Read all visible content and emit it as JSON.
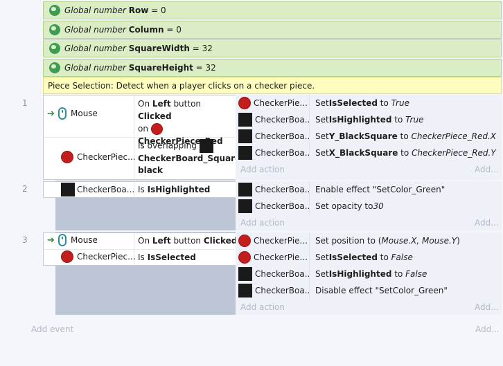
{
  "variables": [
    {
      "prefix": "Global number ",
      "name": "Row",
      "suffix": " = 0"
    },
    {
      "prefix": "Global number ",
      "name": "Column",
      "suffix": " = 0"
    },
    {
      "prefix": "Global number ",
      "name": "SquareWidth",
      "suffix": " = 32"
    },
    {
      "prefix": "Global number ",
      "name": "SquareHeight",
      "suffix": " = 32"
    }
  ],
  "comment": "Piece Selection: Detect when a player clicks on a checker piece.",
  "events": [
    {
      "number": "1",
      "conditions": [
        {
          "object": "Mouse",
          "text": {
            "p1": "On ",
            "b1": "Left",
            "p2": " button ",
            "b2": "Clicked",
            "p3": "on",
            "b3": "CheckerPiece_Red"
          }
        },
        {
          "object": "CheckerPiec...",
          "text": {
            "p1": "Is overlapping",
            "b1": "CheckerBoard_Square",
            "b2": "black"
          }
        }
      ],
      "actions": [
        {
          "object": "CheckerPie...",
          "icon": "red-piece",
          "p1": "Set ",
          "b1": "IsSelected",
          "p2": " to ",
          "i1": "True"
        },
        {
          "object": "CheckerBoa...",
          "icon": "black-square",
          "p1": "Set ",
          "b1": "IsHighlighted",
          "p2": " to ",
          "i1": "True"
        },
        {
          "object": "CheckerBoa...",
          "icon": "black-square",
          "p1": "Set ",
          "b1": "Y_BlackSquare",
          "p2": " to ",
          "i1": "CheckerPiece_Red.X"
        },
        {
          "object": "CheckerBoa...",
          "icon": "black-square",
          "p1": "Set ",
          "b1": "X_BlackSquare",
          "p2": " to ",
          "i1": "CheckerPiece_Red.Y"
        }
      ]
    },
    {
      "number": "2",
      "conditions": [
        {
          "object": "CheckerBoa...",
          "text": {
            "p1": "Is ",
            "b1": "IsHighlighted"
          }
        }
      ],
      "actions": [
        {
          "object": "CheckerBoa...",
          "icon": "black-square",
          "text": "Enable effect \"SetColor_Green\""
        },
        {
          "object": "CheckerBoa...",
          "icon": "black-square",
          "p1": "Set opacity to ",
          "i1": "30"
        }
      ]
    },
    {
      "number": "3",
      "conditions": [
        {
          "object": "Mouse",
          "text": {
            "p1": "On ",
            "b1": "Left",
            "p2": " button ",
            "b2": "Clicked"
          }
        },
        {
          "object": "CheckerPiec...",
          "text": {
            "p1": "Is ",
            "b1": "IsSelected"
          }
        }
      ],
      "actions": [
        {
          "object": "CheckerPie...",
          "icon": "red-piece",
          "p1": "Set position to (",
          "i1": "Mouse.X, Mouse.Y",
          "p2": ")"
        },
        {
          "object": "CheckerPie...",
          "icon": "red-piece",
          "p1": "Set ",
          "b1": "IsSelected",
          "p2": " to ",
          "i1": "False"
        },
        {
          "object": "CheckerBoa...",
          "icon": "black-square",
          "p1": "Set ",
          "b1": "IsHighlighted",
          "p2": " to ",
          "i1": "False"
        },
        {
          "object": "CheckerBoa...",
          "icon": "black-square",
          "text": "Disable effect \"SetColor_Green\""
        }
      ]
    }
  ],
  "labels": {
    "add_action": "Add action",
    "add_more": "Add...",
    "add_event": "Add event"
  }
}
